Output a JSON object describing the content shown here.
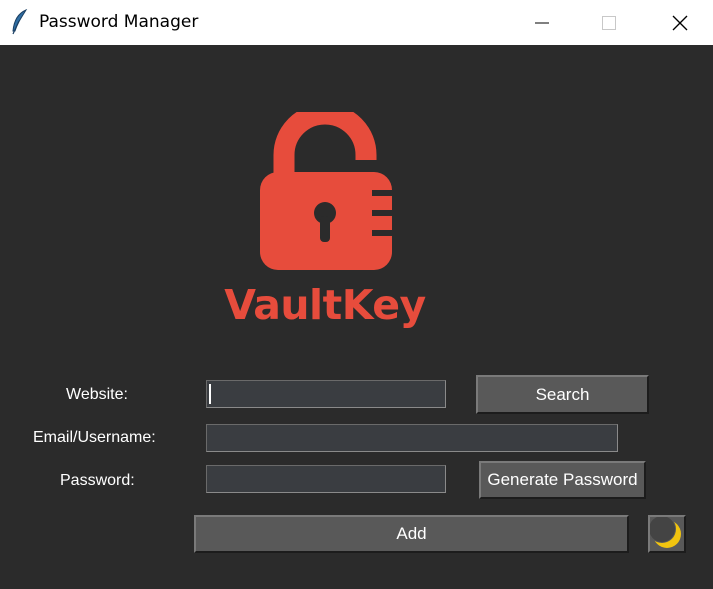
{
  "window": {
    "title": "Password Manager",
    "icon": "feather-icon",
    "controls": [
      "minimize-icon",
      "maximize-icon",
      "close-icon"
    ]
  },
  "logo": {
    "text": "VaultKey",
    "icon": "unlocked-padlock-icon",
    "color": "#e74c3c"
  },
  "form": {
    "website": {
      "label": "Website:",
      "value": "",
      "placeholder": ""
    },
    "email": {
      "label": "Email/Username:",
      "value": "",
      "placeholder": ""
    },
    "password": {
      "label": "Password:",
      "value": "",
      "placeholder": ""
    }
  },
  "buttons": {
    "search": "Search",
    "generate": "Generate Password",
    "add": "Add",
    "theme_toggle_icon": "crescent-moon-icon"
  },
  "colors": {
    "background": "#2b2b2b",
    "entry_bg": "#3a3d41",
    "button_bg": "#595959",
    "moon": "#f1c40f"
  }
}
